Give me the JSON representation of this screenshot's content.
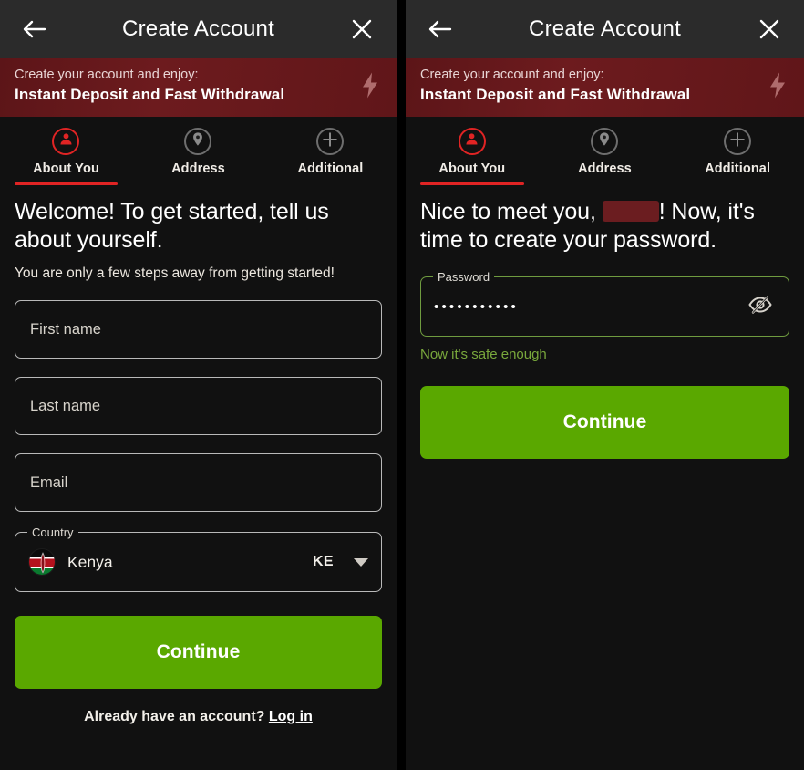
{
  "appbar": {
    "back_icon": "arrow-left-icon",
    "title": "Create Account",
    "close_icon": "close-icon"
  },
  "promo": {
    "line1": "Create your account and enjoy:",
    "line2": "Instant Deposit and Fast Withdrawal",
    "icon": "lightning-bolt-icon",
    "bg_color": "#6d1b1e"
  },
  "stepper": {
    "active_index": 0,
    "accent_color": "#e02424",
    "steps": [
      {
        "label": "About You",
        "icon": "person-icon",
        "active": true
      },
      {
        "label": "Address",
        "icon": "location-pin-icon",
        "active": false
      },
      {
        "label": "Additional",
        "icon": "plus-icon",
        "active": false
      }
    ]
  },
  "left_screen": {
    "headline": "Welcome! To get started, tell us about yourself.",
    "subhead": "You are only a few steps away from getting started!",
    "fields": [
      {
        "name": "first-name",
        "placeholder": "First name",
        "value": ""
      },
      {
        "name": "last-name",
        "placeholder": "Last name",
        "value": ""
      },
      {
        "name": "email",
        "placeholder": "Email",
        "value": ""
      }
    ],
    "country": {
      "legend": "Country",
      "name": "Kenya",
      "code": "KE",
      "flag": "kenya-flag-icon",
      "caret": "chevron-down-icon"
    },
    "continue_label": "Continue",
    "footer_text": "Already have an account?",
    "footer_link": "Log in"
  },
  "right_screen": {
    "headline_before": "Nice to meet you, ",
    "headline_redacted": "",
    "headline_after": "! Now, it's time to create your password.",
    "password": {
      "legend": "Password",
      "masked_value": "•••••••••••",
      "toggle_icon": "eye-off-icon",
      "border_color": "#6f9b3f"
    },
    "helper_text": "Now it's safe enough",
    "helper_color": "#79a83c",
    "continue_label": "Continue"
  },
  "colors": {
    "background": "#111111",
    "appbar": "#2b2b2b",
    "primary_button": "#5aa800",
    "redaction": "#6b1d20"
  }
}
